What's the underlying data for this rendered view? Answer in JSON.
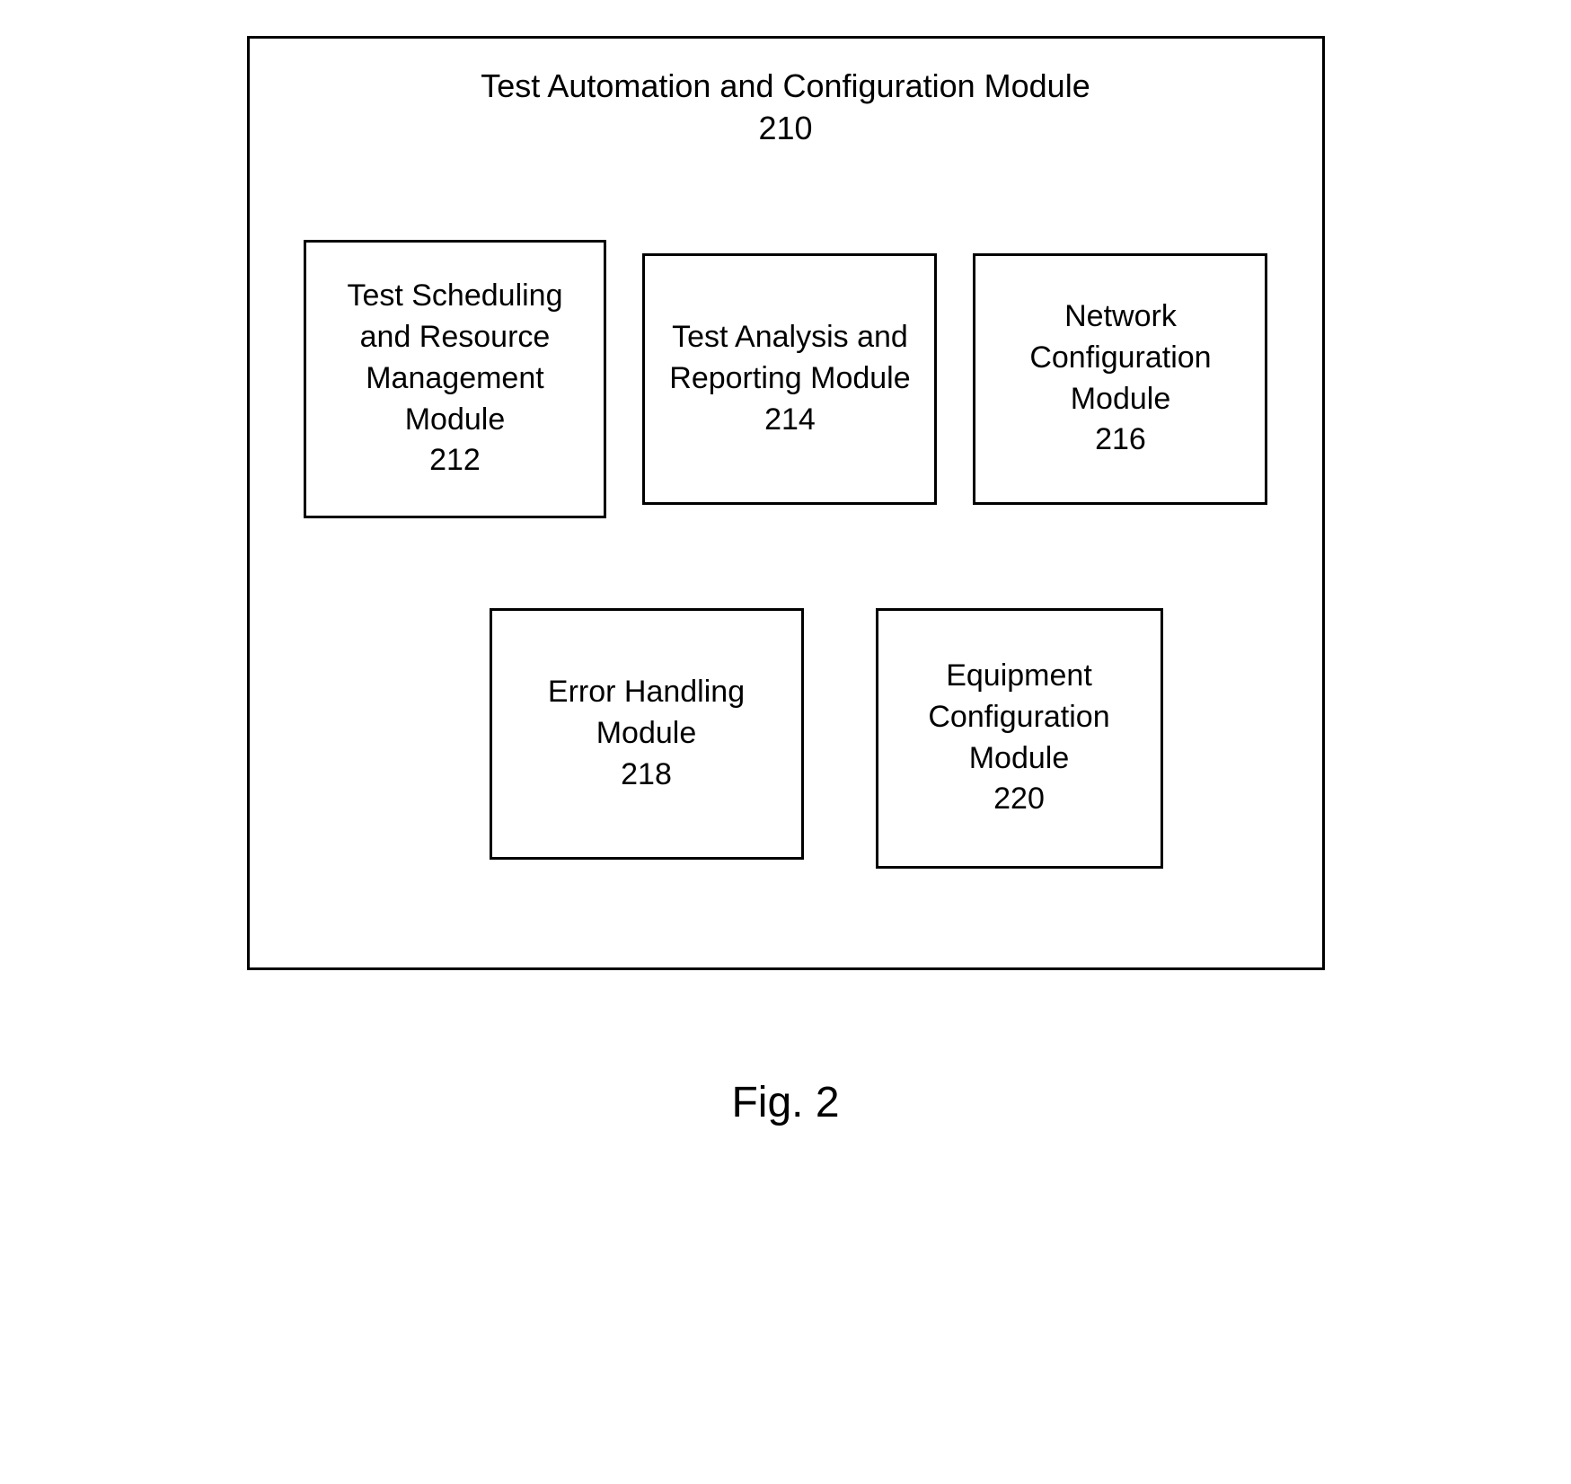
{
  "diagram": {
    "title": "Test Automation and Configuration Module",
    "title_ref": "210",
    "modules": {
      "m212": {
        "name": "Test Scheduling and Resource Management Module",
        "ref": "212"
      },
      "m214": {
        "name": "Test Analysis and Reporting  Module",
        "ref": "214"
      },
      "m216": {
        "name": "Network Configuration Module",
        "ref": "216"
      },
      "m218": {
        "name": "Error Handling Module",
        "ref": "218"
      },
      "m220": {
        "name": "Equipment Configuration Module",
        "ref": "220"
      }
    }
  },
  "figure_label": "Fig. 2"
}
